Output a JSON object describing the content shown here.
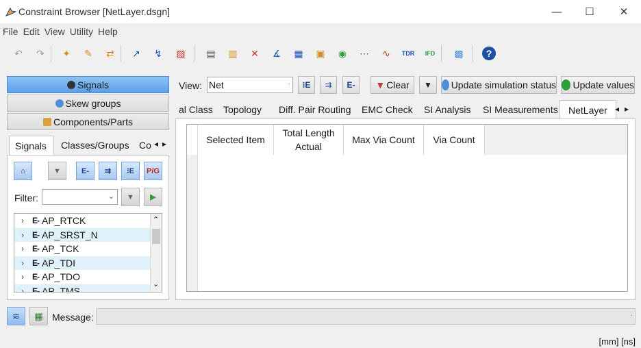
{
  "window": {
    "title": "Constraint Browser [NetLayer.dsgn]",
    "controls": [
      "—",
      "☐",
      "✕"
    ]
  },
  "menu": [
    "File",
    "Edit",
    "View",
    "Utility",
    "Help"
  ],
  "toolbar": {
    "icons": [
      "undo-icon",
      "redo-icon",
      "net-add-icon",
      "net-edit-icon",
      "net-move-icon",
      "route-icon",
      "route-check-icon",
      "layer-icon",
      "doc-icon",
      "doc-list-icon",
      "delete-constraint-icon",
      "measure-icon",
      "grid-icon",
      "folder-icon",
      "refresh-net-icon",
      "bus-icon",
      "waveform-icon",
      "tdr-icon",
      "ifd-icon",
      "layout-icon",
      "help-icon"
    ],
    "glyphs": [
      "↶",
      "↷",
      "✦",
      "✎",
      "⇄",
      "↗",
      "↯",
      "▨",
      "▤",
      "▥",
      "✕",
      "∡",
      "▦",
      "▣",
      "◉",
      "⋯",
      "∿",
      "TDR",
      "IFD",
      "▩",
      "?"
    ]
  },
  "left": {
    "nav_buttons": [
      "Signals",
      "Skew groups",
      "Components/Parts"
    ],
    "tabs": [
      "Signals",
      "Classes/Groups",
      "Co"
    ],
    "filter_label": "Filter:",
    "filter_value": "",
    "signals": [
      "AP_RTCK",
      "AP_SRST_N",
      "AP_TCK",
      "AP_TDI",
      "AP_TDO",
      "AP_TMS"
    ],
    "signal_icon": "E-"
  },
  "right": {
    "view_label": "View:",
    "view_value": "Net",
    "clear_label": "Clear",
    "update_sim_label": "Update simulation status",
    "update_values_label": "Update values",
    "tabs": [
      "al Class",
      "Topology",
      "Diff. Pair Routing",
      "EMC Check",
      "SI Analysis",
      "SI Measurements",
      "NetLayer"
    ],
    "active_tab": "NetLayer",
    "columns": [
      "Selected Item",
      "Total Length Actual",
      "Max Via Count",
      "Via Count"
    ]
  },
  "status": {
    "message_label": "Message:",
    "message_value": "",
    "units": "[mm]  [ns]"
  },
  "colors": {
    "accent_blue": "#5d9fe6",
    "row_alt": "#dff2f9",
    "update_green": "#2e9e3a"
  }
}
